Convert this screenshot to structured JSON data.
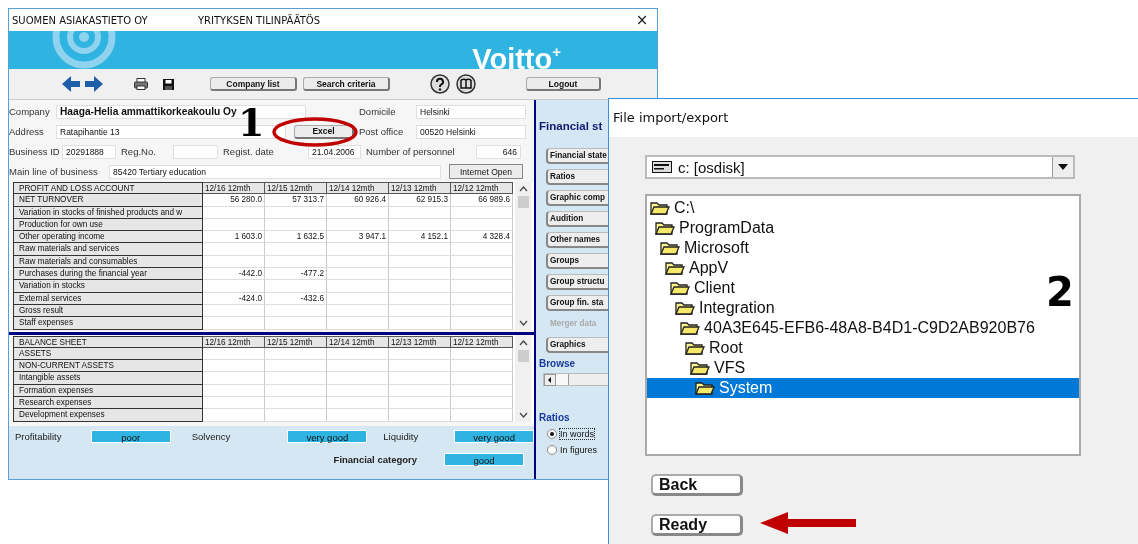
{
  "main_window": {
    "title_left": "SUOMEN ASIAKASTIETO OY",
    "title_center": "YRITYKSEN TILINPÄÄTÖS",
    "close": "×",
    "logo": "Voitto$^{+}$",
    "toolbar_buttons": [
      "Company list",
      "Search criteria",
      "Logout"
    ],
    "company": {
      "label": "Company",
      "value": "Haaga-Helia ammattikorkeakoulu Oy"
    },
    "domicile": {
      "label": "Domicile",
      "value": "Helsinki"
    },
    "address": {
      "label": "Address",
      "value": "Ratapihantie 13"
    },
    "excel_button": "Excel",
    "post_office": {
      "label": "Post office",
      "value": "00520 Helsinki"
    },
    "business_id": {
      "label": "Business ID",
      "value": "20291888"
    },
    "reg_no": {
      "label": "Reg.No."
    },
    "regist_date": {
      "label": "Regist. date",
      "value": "21.04.2006"
    },
    "personnel": {
      "label": "Number of personnel",
      "value": "646"
    },
    "main_line": {
      "label": "Main line of business",
      "value": "85420 Tertiary education"
    },
    "internet_button": "Internet Open",
    "tables": [
      {
        "columns": [
          "PROFIT AND LOSS ACCOUNT",
          "12/16  12mth",
          "12/15  12mth",
          "12/14  12mth",
          "12/13  12mth",
          "12/12  12mth"
        ],
        "rows": [
          {
            "label": "NET TURNOVER",
            "cells": [
              "56 280.0",
              "57 313.7",
              "60 926.4",
              "62 915.3",
              "66 989.6"
            ]
          },
          {
            "label": "Variation in stocks of finished products and w",
            "cells": [
              null,
              null,
              null,
              null,
              null
            ]
          },
          {
            "label": "Production for own use",
            "cells": [
              null,
              null,
              null,
              null,
              null
            ]
          },
          {
            "label": "Other operating income",
            "cells": [
              "1 603.0",
              "1 632.5",
              "3 947.1",
              "4 152.1",
              "4 328.4"
            ]
          },
          {
            "label": "Raw materials and services",
            "cells": [
              null,
              null,
              null,
              null,
              null
            ]
          },
          {
            "label": "Raw materials and consumables",
            "cells": [
              null,
              null,
              null,
              null,
              null
            ]
          },
          {
            "label": "Purchases during the financial year",
            "cells": [
              "-442.0",
              "-477.2",
              null,
              null,
              null
            ]
          },
          {
            "label": "Variation in stocks",
            "cells": [
              null,
              null,
              null,
              null,
              null
            ]
          },
          {
            "label": "External services",
            "cells": [
              "-424.0",
              "-432.6",
              null,
              null,
              null
            ]
          },
          {
            "label": "Gross result",
            "cells": [
              null,
              null,
              null,
              null,
              null
            ]
          },
          {
            "label": "Staff expenses",
            "cells": [
              null,
              null,
              null,
              null,
              null
            ]
          }
        ]
      },
      {
        "columns": [
          "BALANCE SHEET",
          "12/16  12mth",
          "12/15  12mth",
          "12/14  12mth",
          "12/13  12mth",
          "12/12  12mth"
        ],
        "rows": [
          {
            "label": "ASSETS",
            "cells": [
              null,
              null,
              null,
              null,
              null
            ]
          },
          {
            "label": "NON-CURRENT ASSETS",
            "cells": [
              null,
              null,
              null,
              null,
              null
            ]
          },
          {
            "label": "Intangible assets",
            "cells": [
              null,
              null,
              null,
              null,
              null
            ]
          },
          {
            "label": "Formation expenses",
            "cells": [
              null,
              null,
              null,
              null,
              null
            ]
          },
          {
            "label": "Research expenses",
            "cells": [
              null,
              null,
              null,
              null,
              null
            ]
          },
          {
            "label": "Development expenses",
            "cells": [
              null,
              null,
              null,
              null,
              null
            ]
          }
        ]
      }
    ],
    "ratings": [
      {
        "label": "Profitability",
        "value": "poor"
      },
      {
        "label": "Solvency",
        "value": "very good"
      },
      {
        "label": "Liquidity",
        "value": "very good"
      }
    ],
    "financial_category": {
      "label": "Financial category",
      "value": "good"
    },
    "panel": {
      "heading": "Financial st",
      "buttons": [
        {
          "label": "Financial state",
          "disabled": false
        },
        {
          "label": "Ratios",
          "disabled": false
        },
        {
          "label": "Graphic comp",
          "disabled": false
        },
        {
          "label": "Audition",
          "disabled": false
        },
        {
          "label": "Other names",
          "disabled": false
        },
        {
          "label": "Groups",
          "disabled": false
        },
        {
          "label": "Group structu",
          "disabled": false
        },
        {
          "label": "Group fin. sta",
          "disabled": false
        },
        {
          "label": "Merger data",
          "disabled": true
        },
        {
          "label": "Graphics",
          "disabled": false
        }
      ],
      "browse_label": "Browse",
      "ratios_label": "Ratios",
      "ratio_options": [
        {
          "label": "In words",
          "selected": true
        },
        {
          "label": "In figures",
          "selected": false
        }
      ]
    }
  },
  "dialog": {
    "title": "File import/export",
    "drive": "c: [osdisk]",
    "tree": {
      "label": "C:\\",
      "selected": false,
      "children": [
        {
          "label": "ProgramData",
          "selected": false,
          "children": [
            {
              "label": "Microsoft",
              "selected": false,
              "children": [
                {
                  "label": "AppV",
                  "selected": false,
                  "children": [
                    {
                      "label": "Client",
                      "selected": false,
                      "children": [
                        {
                          "label": "Integration",
                          "selected": false,
                          "children": [
                            {
                              "label": "40A3E645-EFB6-48A8-B4D1-C9D2AB920B76",
                              "selected": false,
                              "children": [
                                {
                                  "label": "Root",
                                  "selected": false,
                                  "children": [
                                    {
                                      "label": "VFS",
                                      "selected": false,
                                      "children": [
                                        {
                                          "label": "System",
                                          "selected": true
                                        }
                                      ]
                                    }
                                  ]
                                }
                              ]
                            }
                          ]
                        }
                      ]
                    }
                  ]
                }
              ]
            }
          ]
        }
      ]
    },
    "buttons": [
      "Back",
      "Ready"
    ]
  },
  "annotations": [
    {
      "kind": "number",
      "text": "1"
    },
    {
      "kind": "ellipse"
    },
    {
      "kind": "number",
      "text": "2"
    },
    {
      "kind": "arrow"
    }
  ]
}
